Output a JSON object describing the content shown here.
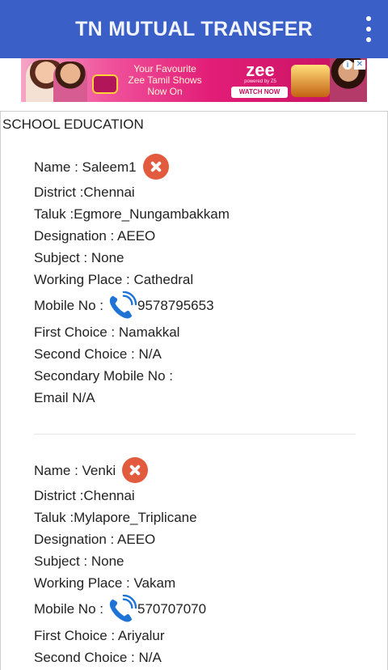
{
  "appbar": {
    "title": "TN MUTUAL TRANSFER"
  },
  "ad": {
    "line1": "Your Favourite",
    "line2": "Zee Tamil Shows",
    "line3": "Now On",
    "brand": "zee",
    "brand_sub": "powered by Z5",
    "cta": "WATCH NOW"
  },
  "section": {
    "title": "SCHOOL EDUCATION"
  },
  "records": [
    {
      "name": "Name : Saleem1",
      "district": "District :Chennai",
      "taluk": "Taluk :Egmore_Nungambakkam",
      "designation": "Designation : AEEO",
      "subject": "Subject : None",
      "working_place": "Working Place : Cathedral",
      "mobile_label": "Mobile No :",
      "mobile_number": "9578795653",
      "first_choice": "First Choice : Namakkal",
      "second_choice": "Second Choice : N/A",
      "secondary_mobile": "Secondary Mobile No :",
      "email": "Email N/A"
    },
    {
      "name": "Name : Venki",
      "district": "District :Chennai",
      "taluk": "Taluk :Mylapore_Triplicane",
      "designation": "Designation : AEEO",
      "subject": "Subject : None",
      "working_place": "Working Place : Vakam",
      "mobile_label": "Mobile No :",
      "mobile_number": "570707070",
      "first_choice": "First Choice : Ariyalur",
      "second_choice": "Second Choice : N/A"
    }
  ],
  "colors": {
    "appbar": "#3a5fc7",
    "delete_icon": "#e35b3f",
    "phone_icon": "#1e73d6"
  }
}
